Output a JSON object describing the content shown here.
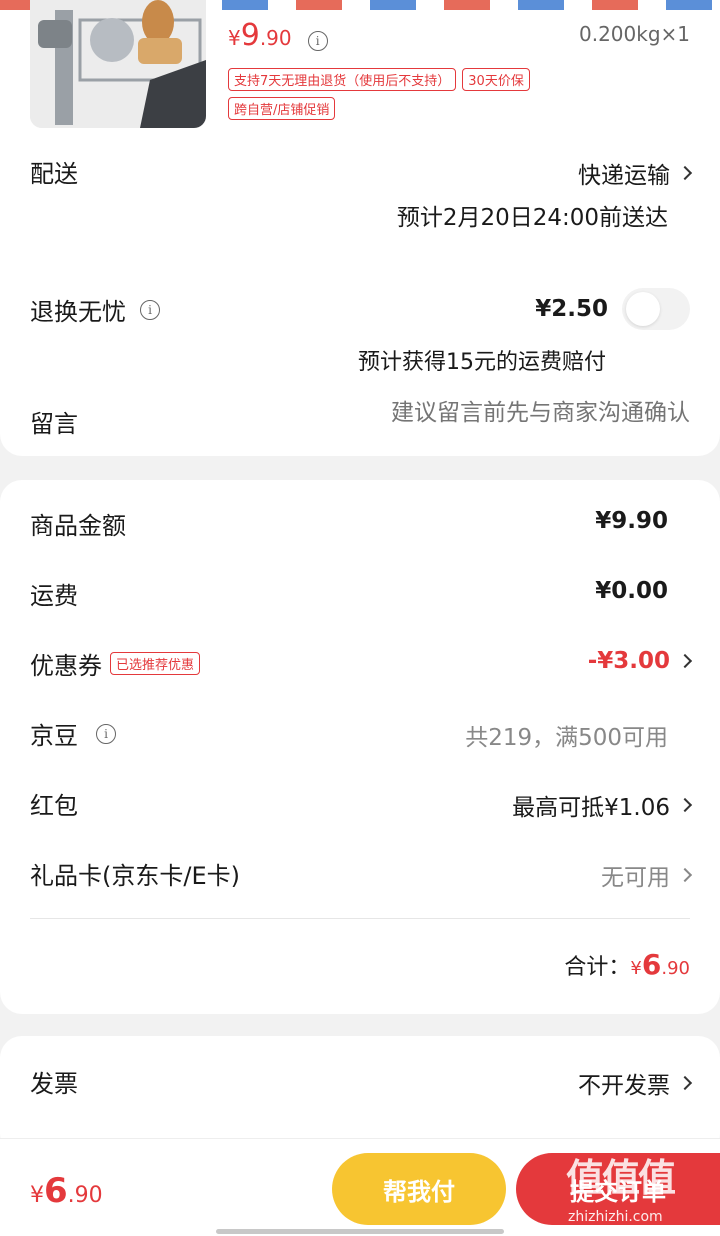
{
  "product": {
    "price_symbol": "¥",
    "price_int": "9",
    "price_dec": ".90",
    "weight_qty": "0.200kg×1",
    "tags": [
      "支持7天无理由退货（使用后不支持）",
      "30天价保",
      "跨自营/店铺促销"
    ]
  },
  "delivery": {
    "label": "配送",
    "method": "快递运输",
    "eta": "预计2月20日24:00前送达"
  },
  "return_worry": {
    "label": "退换无忧",
    "price": "¥2.50",
    "note": "预计获得15元的运费赔付"
  },
  "message": {
    "label": "留言",
    "placeholder": "建议留言前先与商家沟通确认"
  },
  "summary": {
    "goods_amount_label": "商品金额",
    "goods_amount": "¥9.90",
    "shipping_label": "运费",
    "shipping": "¥0.00",
    "coupon_label": "优惠券",
    "coupon_badge": "已选推荐优惠",
    "coupon_value": "-¥3.00",
    "jingdou_label": "京豆",
    "jingdou_value": "共219，满500可用",
    "redpack_label": "红包",
    "redpack_value": "最高可抵¥1.06",
    "giftcard_label": "礼品卡(京东卡/E卡)",
    "giftcard_value": "无可用",
    "total_label": "合计：",
    "total_symbol": "¥",
    "total_int": "6",
    "total_dec": ".90"
  },
  "invoice": {
    "label": "发票",
    "value": "不开发票"
  },
  "bottom": {
    "symbol": "¥",
    "int": "6",
    "dec": ".90",
    "help_pay": "帮我付",
    "submit": "提交订单"
  },
  "watermark": {
    "logo": "值值值",
    "site": "zhizhizhi.com"
  },
  "colors": {
    "accent_red": "#e4393c",
    "help_pay_yellow": "#f7c531"
  }
}
